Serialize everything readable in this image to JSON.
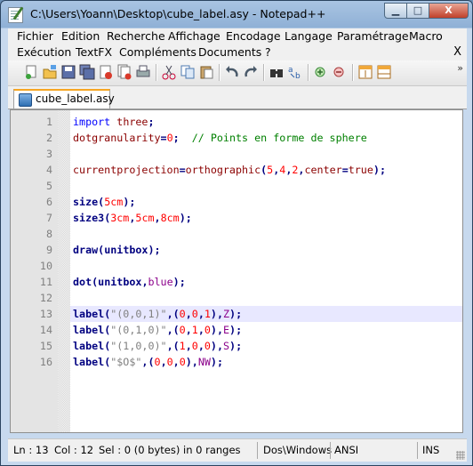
{
  "window": {
    "title": "C:\\Users\\Yoann\\Desktop\\cube_label.asy - Notepad++"
  },
  "window_controls": {
    "minimize": "▁",
    "maximize": "□",
    "close": "X"
  },
  "menu": {
    "row1": [
      "Fichier",
      "Edition",
      "Recherche",
      "Affichage",
      "Encodage",
      "Langage",
      "Paramétrage",
      "Macro"
    ],
    "row2": [
      "Exécution",
      "TextFX",
      "Compléments",
      "Documents",
      "?"
    ],
    "close": "X"
  },
  "toolbar": {
    "icons": [
      "new-file",
      "open-file",
      "save",
      "save-all",
      "close",
      "close-all",
      "print",
      "cut",
      "copy",
      "paste",
      "undo",
      "redo",
      "find",
      "replace",
      "zoom-in",
      "zoom-out",
      "sync-vertical",
      "sync-horizontal"
    ],
    "more": "»"
  },
  "tab": {
    "label": "cube_label.asy"
  },
  "editor": {
    "current_line": 13,
    "lines": [
      {
        "n": "1",
        "code": "import three;"
      },
      {
        "n": "2",
        "code": "dotgranularity=0;  // Points en forme de sphere"
      },
      {
        "n": "3",
        "code": ""
      },
      {
        "n": "4",
        "code": "currentprojection=orthographic(5,4,2,center=true);"
      },
      {
        "n": "5",
        "code": ""
      },
      {
        "n": "6",
        "code": "size(5cm);"
      },
      {
        "n": "7",
        "code": "size3(3cm,5cm,8cm);"
      },
      {
        "n": "8",
        "code": ""
      },
      {
        "n": "9",
        "code": "draw(unitbox);"
      },
      {
        "n": "10",
        "code": ""
      },
      {
        "n": "11",
        "code": "dot(unitbox,blue);"
      },
      {
        "n": "12",
        "code": ""
      },
      {
        "n": "13",
        "code": "label(\"(0,0,1)\",(0,0,1),Z);"
      },
      {
        "n": "14",
        "code": "label(\"(0,1,0)\",(0,1,0),E);"
      },
      {
        "n": "15",
        "code": "label(\"(1,0,0)\",(1,0,0),S);"
      },
      {
        "n": "16",
        "code": "label(\"$O$\",(0,0,0),NW);"
      }
    ]
  },
  "status": {
    "ln": "Ln : 13",
    "col": "Col : 12",
    "sel": "Sel : 0 (0 bytes) in 0 ranges",
    "eol": "Dos\\Windows",
    "encoding": "ANSI",
    "mode": "INS"
  },
  "colors": {
    "title_gradient_top": "#a9c4e2",
    "tab_accent": "#f6a623",
    "current_line": "#e8e8ff"
  }
}
